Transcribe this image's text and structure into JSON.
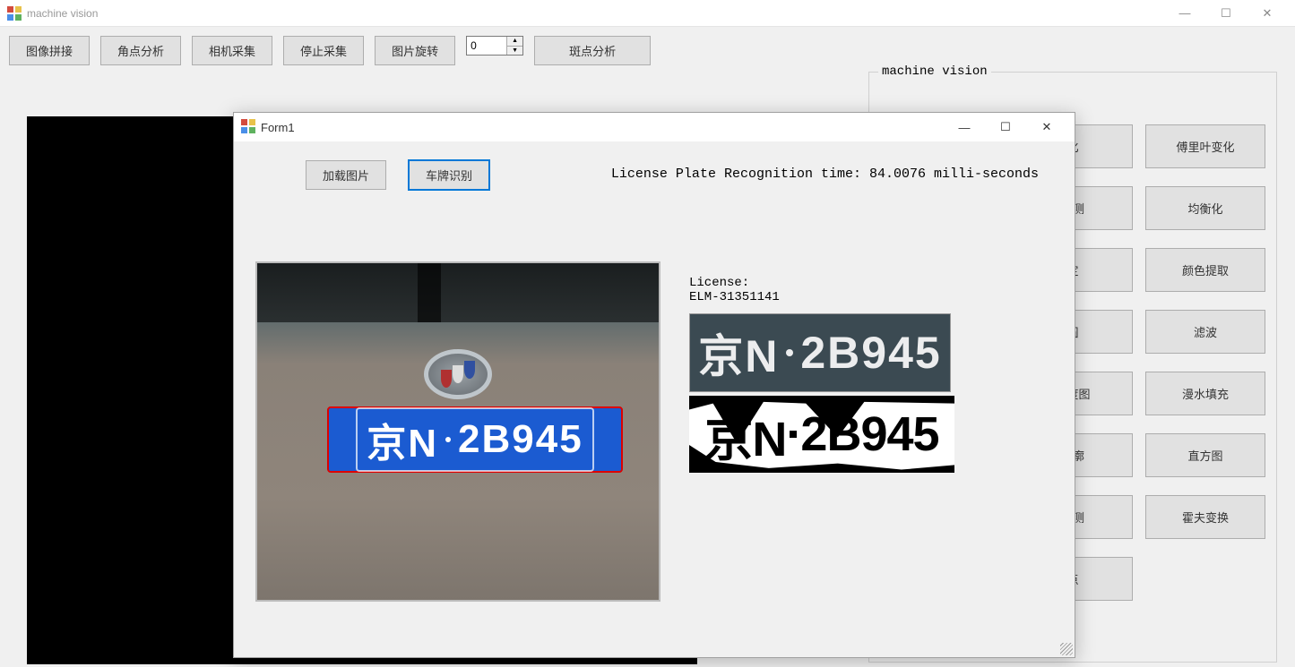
{
  "main_window": {
    "title": "machine vision"
  },
  "toolbar": {
    "btn_stitch": "图像拼接",
    "btn_corner": "角点分析",
    "btn_camera": "相机采集",
    "btn_stop": "停止采集",
    "btn_rotate": "图片旋转",
    "spinner_value": "0",
    "btn_blob": "斑点分析"
  },
  "groupbox": {
    "title": "machine vision",
    "buttons": {
      "r0c2_partial": "化",
      "r0c3": "傅里叶变化",
      "r1c2_partial": "检测",
      "r1c3": "均衡化",
      "r2c2_partial": "定",
      "r2c3": "颜色提取",
      "r3c2_partial": "圆",
      "r3c3": "滤波",
      "r4c2_partial": "灰度图",
      "r4c3": "漫水填充",
      "r5c2_partial": "轮廓",
      "r5c3": "直方图",
      "r6c2_partial": "检测",
      "r6c3": "霍夫变换",
      "r7c2_partial": "点"
    }
  },
  "dialog": {
    "title": "Form1",
    "btn_load": "加载图片",
    "btn_recognize": "车牌识别",
    "recognition_time_text": "License Plate Recognition time: 84.0076 milli-seconds",
    "license_label": "License:",
    "license_value": "ELM-31351141",
    "plate_text_prefix": "京N",
    "plate_text_suffix": "2B945"
  }
}
